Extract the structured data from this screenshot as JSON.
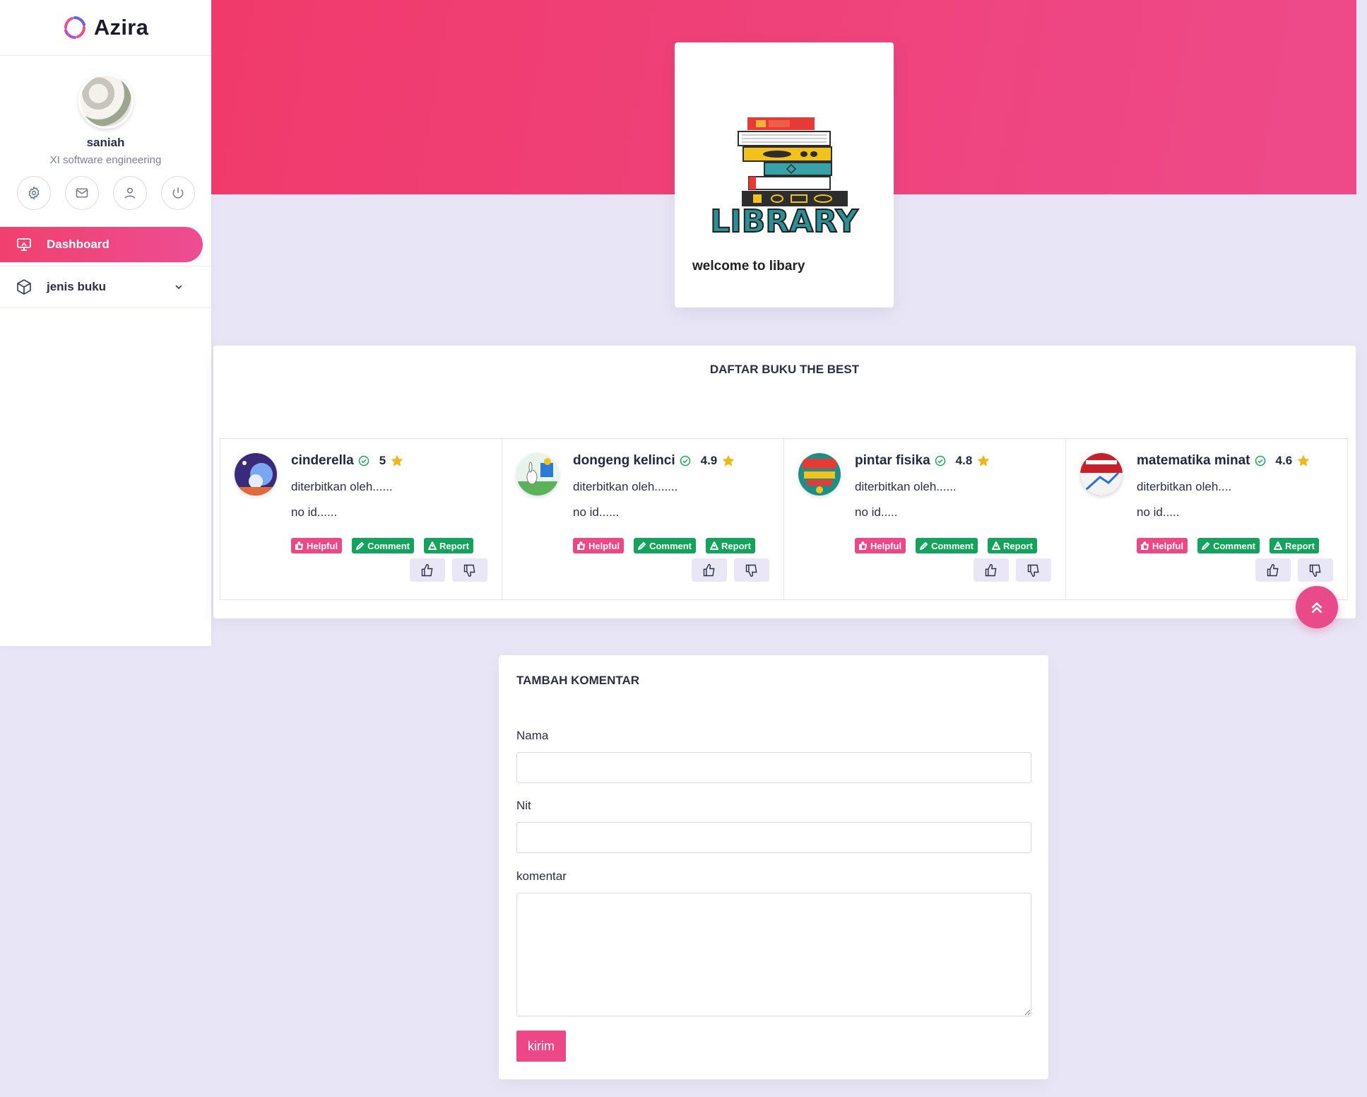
{
  "brand": {
    "name": "Azira"
  },
  "profile": {
    "name": "saniah",
    "role": "XI software engineering"
  },
  "menu": {
    "items": [
      {
        "label": "Dashboard"
      },
      {
        "label": "jenis buku"
      }
    ]
  },
  "welcome": {
    "text": "welcome to libary",
    "art_label": "LIBRARY"
  },
  "best": {
    "title": "DAFTAR BUKU THE BEST",
    "books": [
      {
        "title": "cinderella",
        "rating": "5",
        "publisher": "diterbitkan oleh......",
        "id": "no id......"
      },
      {
        "title": "dongeng kelinci",
        "rating": "4.9",
        "publisher": "diterbitkan oleh.......",
        "id": "no id......"
      },
      {
        "title": "pintar fisika",
        "rating": "4.8",
        "publisher": "diterbitkan oleh......",
        "id": "no id....."
      },
      {
        "title": "matematika minat",
        "rating": "4.6",
        "publisher": "diterbitkan oleh....",
        "id": "no id....."
      }
    ],
    "tags": {
      "helpful": "Helpful",
      "comment": "Comment",
      "report": "Report"
    }
  },
  "comment_form": {
    "title": "TAMBAH KOMENTAR",
    "name_label": "Nama",
    "nit_label": "Nit",
    "comment_label": "komentar",
    "submit_label": "kirim"
  },
  "colors": {
    "accent": "#ee4786",
    "hero_start": "#f03a6b",
    "hero_end": "#ee4a8a",
    "success": "#14a35c",
    "background": "#e8e6f6"
  }
}
